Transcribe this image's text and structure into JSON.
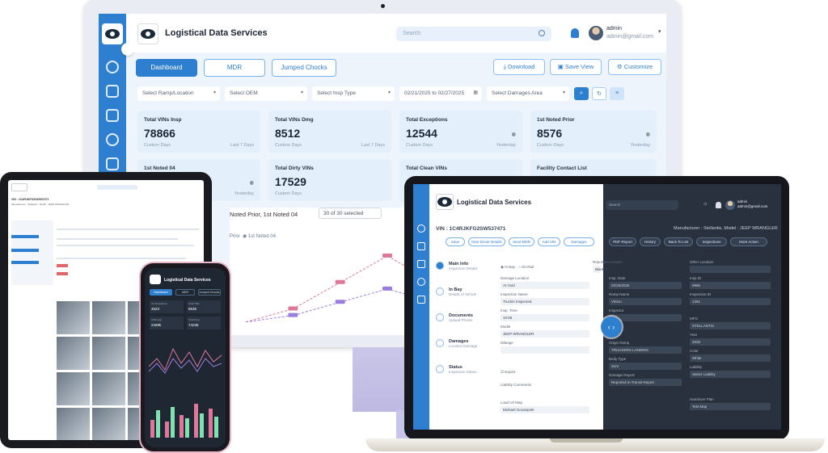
{
  "app": {
    "brand": "Logistical Data Services"
  },
  "monitor": {
    "search_placeholder": "Search",
    "user_name": "admin",
    "user_email": "admin@gmail.com",
    "tabs": [
      "Dashboard",
      "MDR",
      "Jumped Chocks"
    ],
    "actions": [
      "Download",
      "Save View",
      "Customize"
    ],
    "filters": [
      "Select Ramp/Location",
      "Select OEM",
      "Select Insp Type",
      "02/21/2025 to 02/27/2025",
      "Select Damages Area"
    ],
    "cards": [
      {
        "title": "Total VINs Insp",
        "value": "78866",
        "sub1": "Custom Days",
        "sub2": "Last 7 Days"
      },
      {
        "title": "Total VINs Dmg",
        "value": "8512",
        "sub1": "Custom Days",
        "sub2": "Last 7 Days"
      },
      {
        "title": "Total Exceptions",
        "value": "12544",
        "sub1": "Custom Days",
        "sub2": "Yesterday"
      },
      {
        "title": "1st Noted Prior",
        "value": "8576",
        "sub1": "Custom Days",
        "sub2": "Yesterday"
      },
      {
        "title": "1st Noted 04",
        "value": "",
        "sub1": "Custom Days",
        "sub2": "Yesterday"
      },
      {
        "title": "Total Dirty VINs",
        "value": "17529",
        "sub1": "Custom Days",
        "sub2": ""
      },
      {
        "title": "Total Clean VINs",
        "value": "",
        "sub1": "",
        "sub2": ""
      },
      {
        "title": "Facility Contact List",
        "value": "",
        "sub1": "",
        "sub2": ""
      }
    ],
    "chart_heading": "Noted Prior, 1st Noted 04",
    "chart_select": "30 of 30 selected",
    "chart_legend": [
      "Prior",
      "1st Noted 04"
    ]
  },
  "laptop": {
    "vin": "VIN : 1C4RJKFG2SW537471",
    "manufacturer": "Manufacturer : Stellantis, Model : JEEP WRANGLER",
    "user_name": "admin",
    "user_email": "admin@gmail.com",
    "search_placeholder": "Search",
    "left_actions": [
      "Save",
      "Next Driver Details",
      "Send MDR",
      "Add VIN"
    ],
    "right_actions": [
      "Damages",
      "PDF Report",
      "History",
      "Back To List",
      "Inspections",
      "More Action"
    ],
    "steps": [
      {
        "label": "Main Info",
        "sub": "Inspection Details"
      },
      {
        "label": "In Bay",
        "sub": "Details of Vehicle"
      },
      {
        "label": "Documents",
        "sub": "Upload Photos"
      },
      {
        "label": "Damages",
        "sub": "Location Damage"
      },
      {
        "label": "Status",
        "sub": "Inspection Status"
      }
    ],
    "radios": [
      "In Bay",
      "On Rail"
    ],
    "fields_left": [
      {
        "label": "Damage Location",
        "value": "At Yard"
      },
      {
        "label": "Inspection Name",
        "value": "Truckin Inspected"
      },
      {
        "label": "Insp. Time",
        "value": "10:58"
      },
      {
        "label": "Model",
        "value": "JEEP WRANGLER"
      },
      {
        "label": "Mileage",
        "value": ""
      }
    ],
    "fields_mid": [
      {
        "label": "Reported Location",
        "value": "Blanton"
      },
      {
        "label": "Insp. Date",
        "value": "02/26/2025"
      },
      {
        "label": "Ramp Name",
        "value": "Vinton"
      },
      {
        "label": "Inspector",
        "value": ""
      },
      {
        "label": "Origin Ramp",
        "value": "TRUCKERS LANDING"
      },
      {
        "label": "Body Type",
        "value": "SUV"
      },
      {
        "label": "Damage Report",
        "value": "Reported In Transit Report"
      }
    ],
    "fields_right": [
      {
        "label": "Other Location",
        "value": ""
      },
      {
        "label": "Insp ID",
        "value": "9966"
      },
      {
        "label": "Inspection ID",
        "value": "1391"
      },
      {
        "label": "MFG",
        "value": "STELLANTIS"
      },
      {
        "label": "Year",
        "value": "2025"
      },
      {
        "label": "Color",
        "value": "White"
      },
      {
        "label": "Liability",
        "value": "Select Liability"
      },
      {
        "label": "Handover Plan",
        "value": "Test Map"
      }
    ],
    "export_label": "Export",
    "liability_comments": "Liability Comments",
    "load_url": "Load Url Map",
    "driver": "Michael Goosepole"
  },
  "tablet": {
    "vin": "VIN : 1C4RJKFG2SW537471",
    "manufacturer": "Manufacturer : Stellantis , Model : JEEP WRANGLER"
  },
  "phone": {
    "brand": "Logistical Data Services",
    "tabs": [
      "Dashboard",
      "MDR",
      "Jumped Chocks"
    ],
    "stats": [
      {
        "label": "Vin Exceptions",
        "value": "4523"
      },
      {
        "label": "Total VINs",
        "value": "8535"
      },
      {
        "label": "VINs Insp",
        "value": "2469k"
      },
      {
        "label": "Total Dmg",
        "value": "74235"
      }
    ]
  },
  "chart_data": {
    "type": "line",
    "title": "",
    "series": [
      {
        "name": "Prior",
        "values": [
          1,
          3,
          7,
          11,
          7,
          3,
          1
        ]
      },
      {
        "name": "1st Noted 04",
        "values": [
          1,
          2,
          4,
          6,
          4,
          2,
          1
        ]
      }
    ],
    "colors": {
      "accent": "#2f7fd1",
      "dark": "#28313d",
      "series_a": "#e0779b",
      "series_b": "#9b7de0"
    }
  }
}
